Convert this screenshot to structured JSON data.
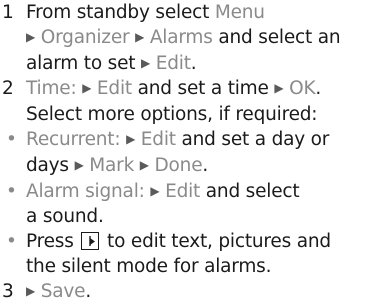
{
  "steps": [
    {
      "number": "1",
      "lines": [
        [
          "From standby select ",
          "Menu"
        ],
        [
          "Organizer",
          "Alarms",
          " and select an"
        ],
        [
          "alarm to set ",
          "Edit",
          "."
        ]
      ]
    },
    {
      "number": "2",
      "line1": [
        "Time:",
        "Edit",
        " and set a time ",
        "OK",
        "."
      ],
      "line2": "Select more options, if required:",
      "bullets": [
        {
          "lines": [
            [
              "Recurrent:",
              "Edit",
              " and set a day or"
            ],
            [
              "days ",
              "Mark",
              "Done",
              "."
            ]
          ]
        },
        {
          "lines": [
            [
              "Alarm signal:",
              "Edit",
              " and select"
            ],
            [
              "a sound."
            ]
          ]
        },
        {
          "lines": [
            [
              "Press ",
              " to edit text, pictures and"
            ],
            [
              "the silent mode for alarms."
            ]
          ]
        }
      ]
    },
    {
      "number": "3",
      "line1": [
        "Save",
        "."
      ]
    }
  ],
  "icons": {
    "arrow": "▶",
    "bullet": "•",
    "softkey": "options-softkey-icon"
  }
}
